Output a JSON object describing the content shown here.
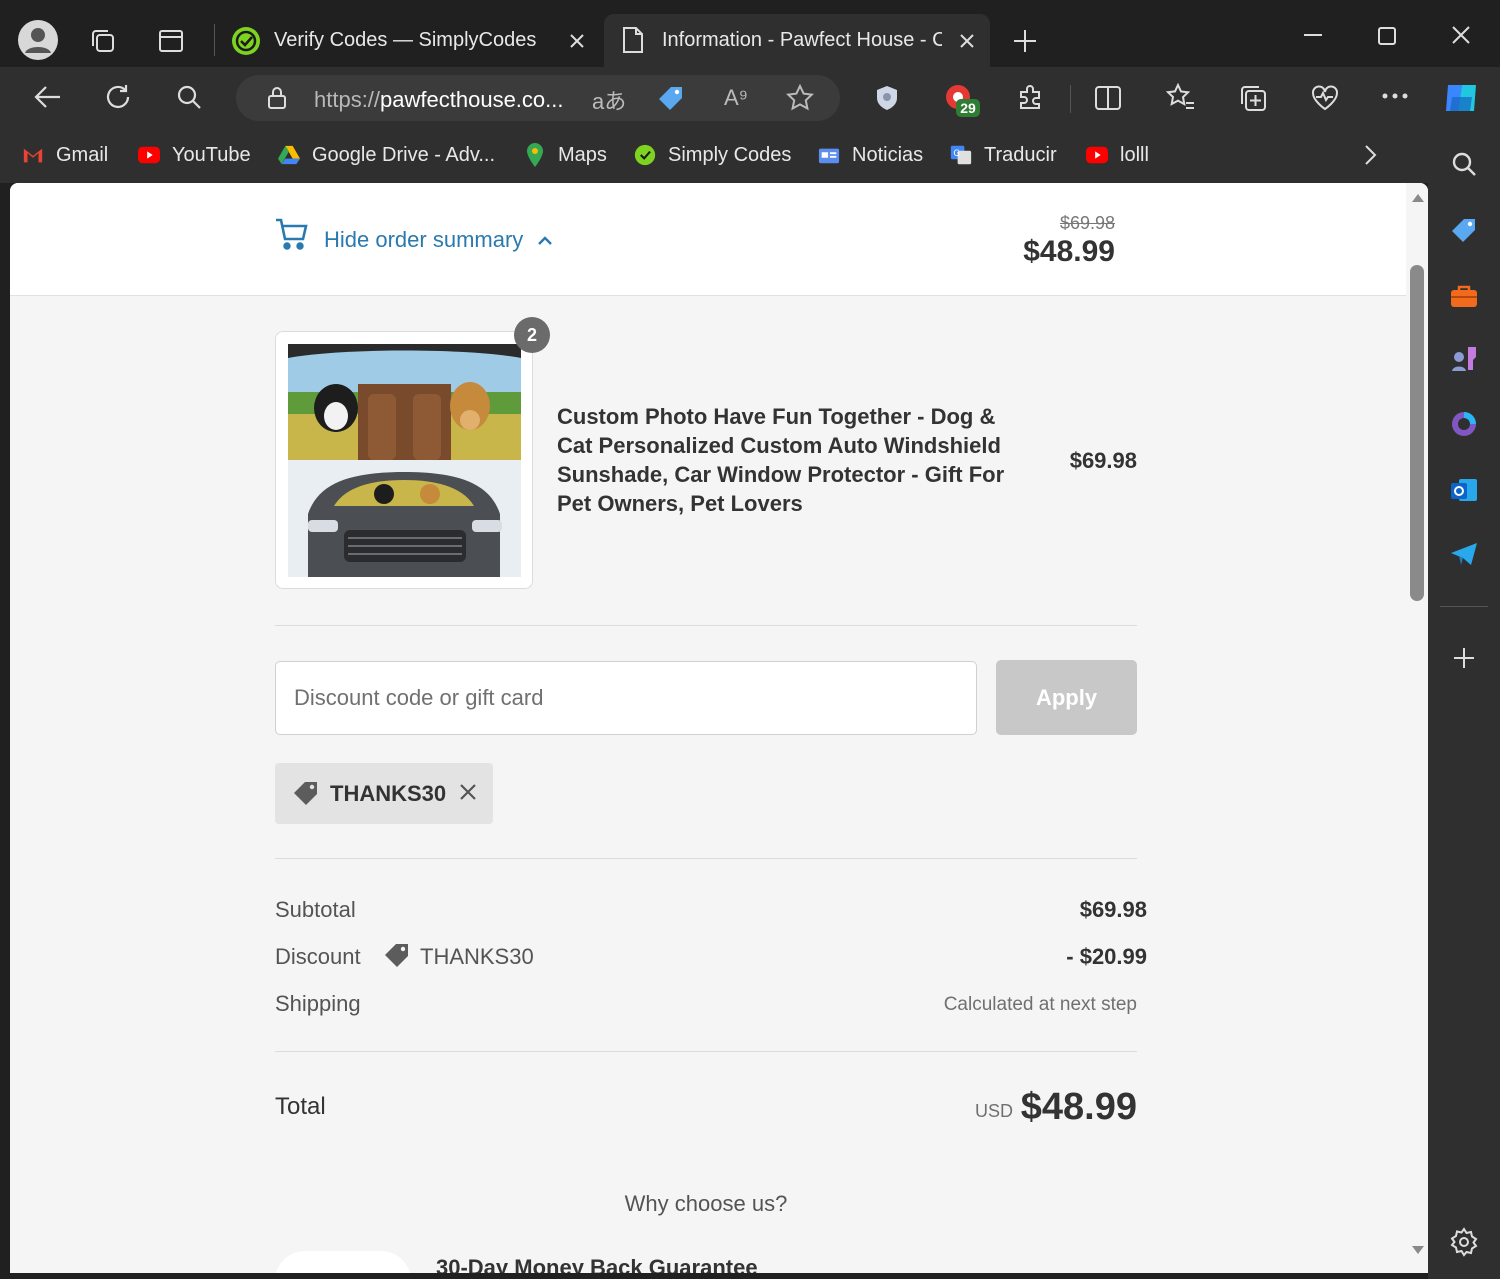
{
  "browser": {
    "tabs": [
      {
        "title": "Verify Codes — SimplyCodes",
        "active": false
      },
      {
        "title": "Information - Pawfect House - Ch",
        "active": true
      }
    ],
    "url_scheme": "https://",
    "url_host": "pawfecthouse.co...",
    "extension_badge": "29",
    "bookmarks": [
      {
        "label": "Gmail",
        "icon": "gmail-icon"
      },
      {
        "label": "YouTube",
        "icon": "youtube-icon"
      },
      {
        "label": "Google Drive - Adv...",
        "icon": "google-drive-icon"
      },
      {
        "label": "Maps",
        "icon": "maps-icon"
      },
      {
        "label": "Simply Codes",
        "icon": "simplycodes-icon"
      },
      {
        "label": "Noticias",
        "icon": "news-icon"
      },
      {
        "label": "Traducir",
        "icon": "translate-icon"
      },
      {
        "label": "lolll",
        "icon": "youtube-icon"
      }
    ]
  },
  "order_header": {
    "toggle_label": "Hide order summary",
    "original_price": "$69.98",
    "total_price": "$48.99"
  },
  "product": {
    "quantity_badge": "2",
    "title": "Custom Photo Have Fun Together - Dog & Cat Personalized Custom Auto Windshield Sunshade, Car Window Protector - Gift For Pet Owners, Pet Lovers",
    "price": "$69.98"
  },
  "discount": {
    "placeholder": "Discount code or gift card",
    "apply_label": "Apply",
    "applied_code": "THANKS30"
  },
  "summary": {
    "subtotal_label": "Subtotal",
    "subtotal_value": "$69.98",
    "discount_label": "Discount",
    "discount_code": "THANKS30",
    "discount_value": "- $20.99",
    "shipping_label": "Shipping",
    "shipping_value": "Calculated at next step",
    "total_label": "Total",
    "currency": "USD",
    "total_value": "$48.99"
  },
  "why": {
    "heading": "Why choose us?",
    "first_item": "30-Day Money Back Guarantee"
  },
  "colors": {
    "link": "#2a7ab0",
    "apply_disabled": "#c8c8c8",
    "browser_dark": "#202020"
  }
}
